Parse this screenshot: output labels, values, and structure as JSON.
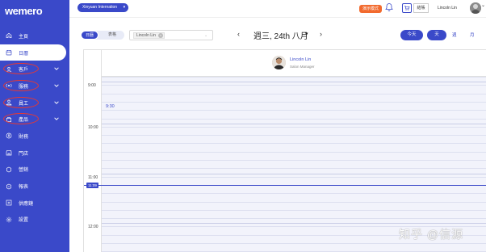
{
  "app": {
    "logo_text": "wemero"
  },
  "sidebar": {
    "items": [
      {
        "label": "主頁",
        "icon": "home-icon",
        "active": false,
        "expandable": false,
        "circled": false
      },
      {
        "label": "日曆",
        "icon": "calendar-icon",
        "active": true,
        "expandable": false,
        "circled": false
      },
      {
        "label": "客戶",
        "icon": "customer-icon",
        "active": false,
        "expandable": true,
        "circled": true
      },
      {
        "label": "服務",
        "icon": "service-icon",
        "active": false,
        "expandable": true,
        "circled": true
      },
      {
        "label": "員工",
        "icon": "staff-icon",
        "active": false,
        "expandable": true,
        "circled": true
      },
      {
        "label": "產品",
        "icon": "product-icon",
        "active": false,
        "expandable": true,
        "circled": true
      },
      {
        "label": "財務",
        "icon": "finance-icon",
        "active": false,
        "expandable": false,
        "circled": false
      },
      {
        "label": "門店",
        "icon": "store-icon",
        "active": false,
        "expandable": false,
        "circled": false
      },
      {
        "label": "營銷",
        "icon": "marketing-icon",
        "active": false,
        "expandable": false,
        "circled": false
      },
      {
        "label": "報表",
        "icon": "report-icon",
        "active": false,
        "expandable": false,
        "circled": false
      },
      {
        "label": "供應鏈",
        "icon": "supply-chain-icon",
        "active": false,
        "expandable": false,
        "circled": false
      },
      {
        "label": "設置",
        "icon": "settings-icon",
        "active": false,
        "expandable": false,
        "circled": false
      }
    ]
  },
  "topbar": {
    "org_name": "Xinyuan Internation",
    "tour_badge": "演示模式",
    "checkout_label": "結賬",
    "user_name": "Lincoln Lin"
  },
  "toolbar": {
    "view_day_tab": "日曆",
    "view_table_tab": "表格",
    "staff_tag": "Lincoln Lin",
    "date_label": "週三, 24th 八月",
    "today_label": "今天",
    "day_label": "天",
    "week_label": "週",
    "month_label": "月"
  },
  "calendar": {
    "staff_name": "Lincoln Lin",
    "staff_role": "Salon Manager",
    "time_labels": [
      "9:00",
      "10:00",
      "11:00",
      "12:00"
    ],
    "slot_label": "9:30",
    "now_label": "11:09"
  },
  "watermark": "知乎 @信源",
  "colors": {
    "brand": "#3a49c9",
    "badge": "#f26a2e",
    "annotation": "#e53935"
  }
}
